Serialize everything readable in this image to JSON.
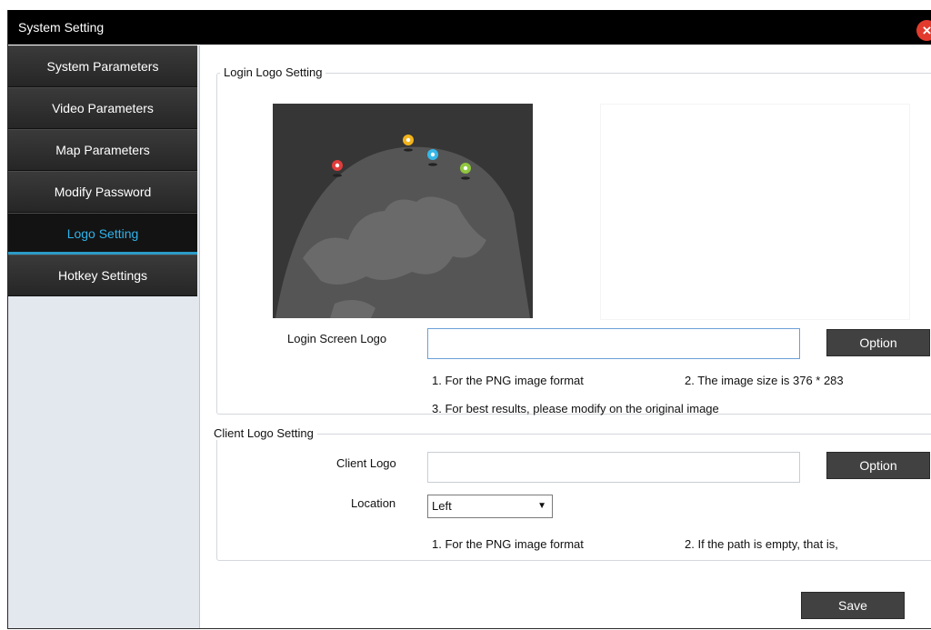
{
  "window": {
    "title": "System Setting"
  },
  "sidebar": {
    "items": [
      {
        "label": "System Parameters"
      },
      {
        "label": "Video Parameters"
      },
      {
        "label": "Map Parameters"
      },
      {
        "label": "Modify Password"
      },
      {
        "label": "Logo Setting"
      },
      {
        "label": "Hotkey Settings"
      }
    ],
    "active": "Logo Setting"
  },
  "login_logo": {
    "group_title": "Login Logo Setting",
    "field_label": "Login Screen Logo",
    "field_value": "",
    "option_label": "Option",
    "note1": "1. For the PNG image format",
    "note2": "2. The image size is 376 * 283",
    "note3": "3. For best results, please modify on the original image"
  },
  "client_logo": {
    "group_title": "Client Logo Setting",
    "field_label": "Client Logo",
    "field_value": "",
    "option_label": "Option",
    "location_label": "Location",
    "location_value": "Left",
    "note1": "1. For the PNG image format",
    "note2": "2. If the path is empty, that is,"
  },
  "footer": {
    "save_label": "Save"
  },
  "colors": {
    "accent": "#2fb3ea",
    "close": "#e23b2e",
    "pins": [
      "#e03c3c",
      "#f2b31b",
      "#35b7e8",
      "#8fc63f"
    ]
  }
}
